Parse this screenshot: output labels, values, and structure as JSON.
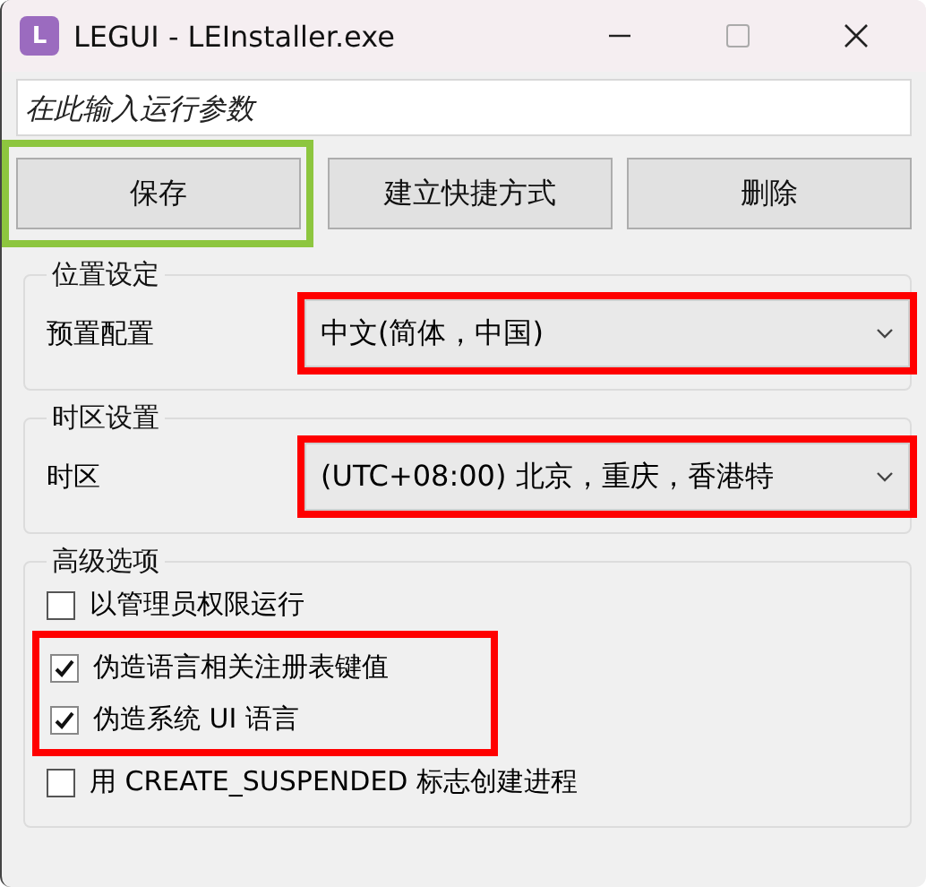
{
  "window": {
    "title": "LEGUI - LEInstaller.exe",
    "app_icon_letter": "L"
  },
  "args_field": {
    "placeholder": "在此输入运行参数"
  },
  "buttons": [
    {
      "label": "保存",
      "color": "#8dc63f"
    },
    {
      "label": "建立快捷方式"
    },
    {
      "label": "删除"
    }
  ],
  "location": {
    "title": "位置设定",
    "label": "预置配置",
    "value": "中文(简体，中国)",
    "color": "#ff0000"
  },
  "timezone": {
    "title": "时区设置",
    "label": "时区",
    "value": "(UTC+08:00) 北京，重庆，香港特",
    "color": "#ff0000"
  },
  "advanced": {
    "title": "高级选项",
    "options": [
      {
        "label": "以管理员权限运行",
        "checked": false
      },
      {
        "label": "伪造语言相关注册表键值",
        "checked": true,
        "color": "#ff0000"
      },
      {
        "label": "伪造系统 UI 语言",
        "checked": true,
        "color": "#ff0000"
      },
      {
        "label": "用 CREATE_SUSPENDED 标志创建进程",
        "checked": false
      }
    ]
  }
}
